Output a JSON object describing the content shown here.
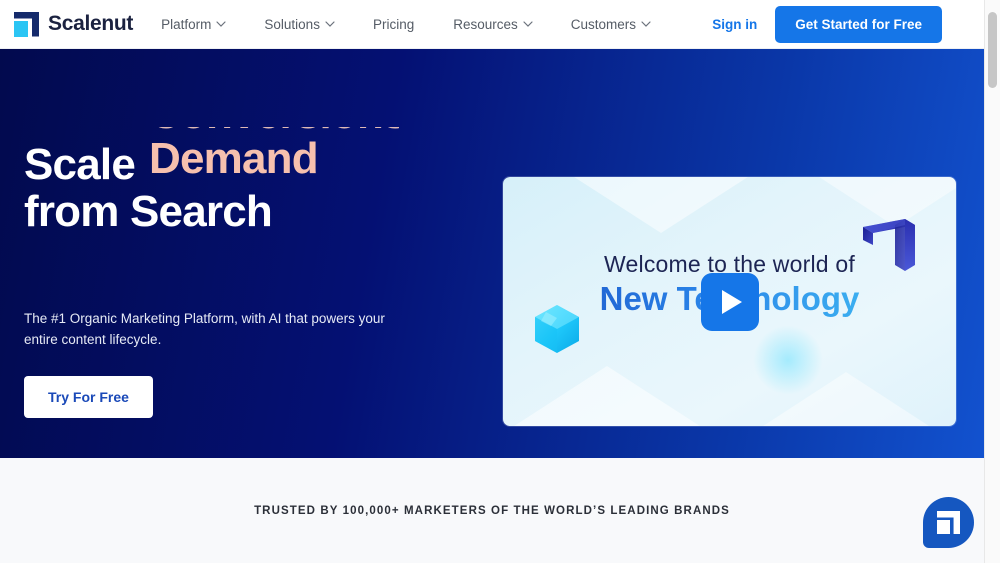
{
  "brand": {
    "name": "Scalenut",
    "logo_icon": "scalenut-logo-icon",
    "logo_dark": "#152a6b",
    "logo_accent": "#2bc5f4"
  },
  "nav": {
    "items": [
      {
        "label": "Platform",
        "has_dropdown": true,
        "icon": "chevron-down-icon"
      },
      {
        "label": "Solutions",
        "has_dropdown": true,
        "icon": "chevron-down-icon"
      },
      {
        "label": "Pricing",
        "has_dropdown": false,
        "icon": ""
      },
      {
        "label": "Resources",
        "has_dropdown": true,
        "icon": "chevron-down-icon"
      },
      {
        "label": "Customers",
        "has_dropdown": true,
        "icon": "chevron-down-icon"
      }
    ],
    "sign_in": "Sign in",
    "cta_label": "Get Started for Free",
    "cta_color": "#1576e8",
    "sign_in_color": "#1576e8"
  },
  "hero": {
    "line1_static": "Scale",
    "rotating_word_previous": "Conversions",
    "rotating_word_current": "Demand",
    "rotating_word_color": "#f6c0ae",
    "line2": "from Search",
    "subhead": "The #1 Organic Marketing Platform, with AI that powers your entire content lifecycle.",
    "button_label": "Try For Free",
    "button_text_color": "#1a49b8",
    "bg_gradient_from": "#020a4e",
    "bg_gradient_to": "#1252cf"
  },
  "video": {
    "line1": "Welcome to the world of",
    "line2": "New Technology",
    "line1_color": "#1d2554",
    "line2_gradient_from": "#1a4fc4",
    "line2_gradient_to": "#46c8f5",
    "play_icon": "play-icon",
    "play_button_color": "#1576e8",
    "decor_logo_icon": "scalenut-3d-logo-icon",
    "decor_crystal_icon": "hexagon-crystal-icon"
  },
  "trusted": {
    "text": "TRUSTED BY 100,000+ MARKETERS OF THE WORLD’S LEADING BRANDS"
  },
  "chat": {
    "icon": "chat-widget-icon",
    "color": "#1557c0"
  },
  "browser": {
    "scrollbar": "vertical-scrollbar"
  }
}
